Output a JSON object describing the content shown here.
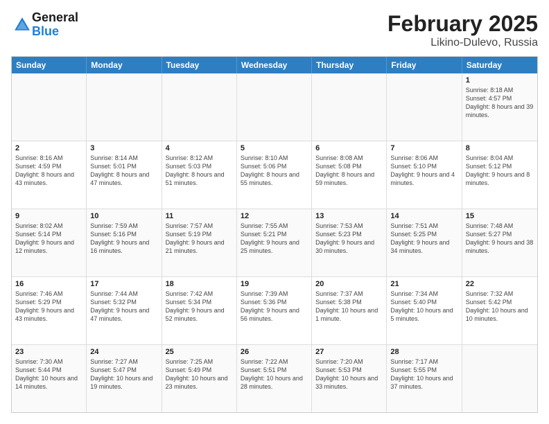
{
  "header": {
    "logo": {
      "general": "General",
      "blue": "Blue"
    },
    "month": "February 2025",
    "location": "Likino-Dulevo, Russia"
  },
  "weekdays": [
    "Sunday",
    "Monday",
    "Tuesday",
    "Wednesday",
    "Thursday",
    "Friday",
    "Saturday"
  ],
  "rows": [
    [
      {
        "day": "",
        "info": ""
      },
      {
        "day": "",
        "info": ""
      },
      {
        "day": "",
        "info": ""
      },
      {
        "day": "",
        "info": ""
      },
      {
        "day": "",
        "info": ""
      },
      {
        "day": "",
        "info": ""
      },
      {
        "day": "1",
        "info": "Sunrise: 8:18 AM\nSunset: 4:57 PM\nDaylight: 8 hours and 39 minutes."
      }
    ],
    [
      {
        "day": "2",
        "info": "Sunrise: 8:16 AM\nSunset: 4:59 PM\nDaylight: 8 hours and 43 minutes."
      },
      {
        "day": "3",
        "info": "Sunrise: 8:14 AM\nSunset: 5:01 PM\nDaylight: 8 hours and 47 minutes."
      },
      {
        "day": "4",
        "info": "Sunrise: 8:12 AM\nSunset: 5:03 PM\nDaylight: 8 hours and 51 minutes."
      },
      {
        "day": "5",
        "info": "Sunrise: 8:10 AM\nSunset: 5:06 PM\nDaylight: 8 hours and 55 minutes."
      },
      {
        "day": "6",
        "info": "Sunrise: 8:08 AM\nSunset: 5:08 PM\nDaylight: 8 hours and 59 minutes."
      },
      {
        "day": "7",
        "info": "Sunrise: 8:06 AM\nSunset: 5:10 PM\nDaylight: 9 hours and 4 minutes."
      },
      {
        "day": "8",
        "info": "Sunrise: 8:04 AM\nSunset: 5:12 PM\nDaylight: 9 hours and 8 minutes."
      }
    ],
    [
      {
        "day": "9",
        "info": "Sunrise: 8:02 AM\nSunset: 5:14 PM\nDaylight: 9 hours and 12 minutes."
      },
      {
        "day": "10",
        "info": "Sunrise: 7:59 AM\nSunset: 5:16 PM\nDaylight: 9 hours and 16 minutes."
      },
      {
        "day": "11",
        "info": "Sunrise: 7:57 AM\nSunset: 5:19 PM\nDaylight: 9 hours and 21 minutes."
      },
      {
        "day": "12",
        "info": "Sunrise: 7:55 AM\nSunset: 5:21 PM\nDaylight: 9 hours and 25 minutes."
      },
      {
        "day": "13",
        "info": "Sunrise: 7:53 AM\nSunset: 5:23 PM\nDaylight: 9 hours and 30 minutes."
      },
      {
        "day": "14",
        "info": "Sunrise: 7:51 AM\nSunset: 5:25 PM\nDaylight: 9 hours and 34 minutes."
      },
      {
        "day": "15",
        "info": "Sunrise: 7:48 AM\nSunset: 5:27 PM\nDaylight: 9 hours and 38 minutes."
      }
    ],
    [
      {
        "day": "16",
        "info": "Sunrise: 7:46 AM\nSunset: 5:29 PM\nDaylight: 9 hours and 43 minutes."
      },
      {
        "day": "17",
        "info": "Sunrise: 7:44 AM\nSunset: 5:32 PM\nDaylight: 9 hours and 47 minutes."
      },
      {
        "day": "18",
        "info": "Sunrise: 7:42 AM\nSunset: 5:34 PM\nDaylight: 9 hours and 52 minutes."
      },
      {
        "day": "19",
        "info": "Sunrise: 7:39 AM\nSunset: 5:36 PM\nDaylight: 9 hours and 56 minutes."
      },
      {
        "day": "20",
        "info": "Sunrise: 7:37 AM\nSunset: 5:38 PM\nDaylight: 10 hours and 1 minute."
      },
      {
        "day": "21",
        "info": "Sunrise: 7:34 AM\nSunset: 5:40 PM\nDaylight: 10 hours and 5 minutes."
      },
      {
        "day": "22",
        "info": "Sunrise: 7:32 AM\nSunset: 5:42 PM\nDaylight: 10 hours and 10 minutes."
      }
    ],
    [
      {
        "day": "23",
        "info": "Sunrise: 7:30 AM\nSunset: 5:44 PM\nDaylight: 10 hours and 14 minutes."
      },
      {
        "day": "24",
        "info": "Sunrise: 7:27 AM\nSunset: 5:47 PM\nDaylight: 10 hours and 19 minutes."
      },
      {
        "day": "25",
        "info": "Sunrise: 7:25 AM\nSunset: 5:49 PM\nDaylight: 10 hours and 23 minutes."
      },
      {
        "day": "26",
        "info": "Sunrise: 7:22 AM\nSunset: 5:51 PM\nDaylight: 10 hours and 28 minutes."
      },
      {
        "day": "27",
        "info": "Sunrise: 7:20 AM\nSunset: 5:53 PM\nDaylight: 10 hours and 33 minutes."
      },
      {
        "day": "28",
        "info": "Sunrise: 7:17 AM\nSunset: 5:55 PM\nDaylight: 10 hours and 37 minutes."
      },
      {
        "day": "",
        "info": ""
      }
    ]
  ]
}
